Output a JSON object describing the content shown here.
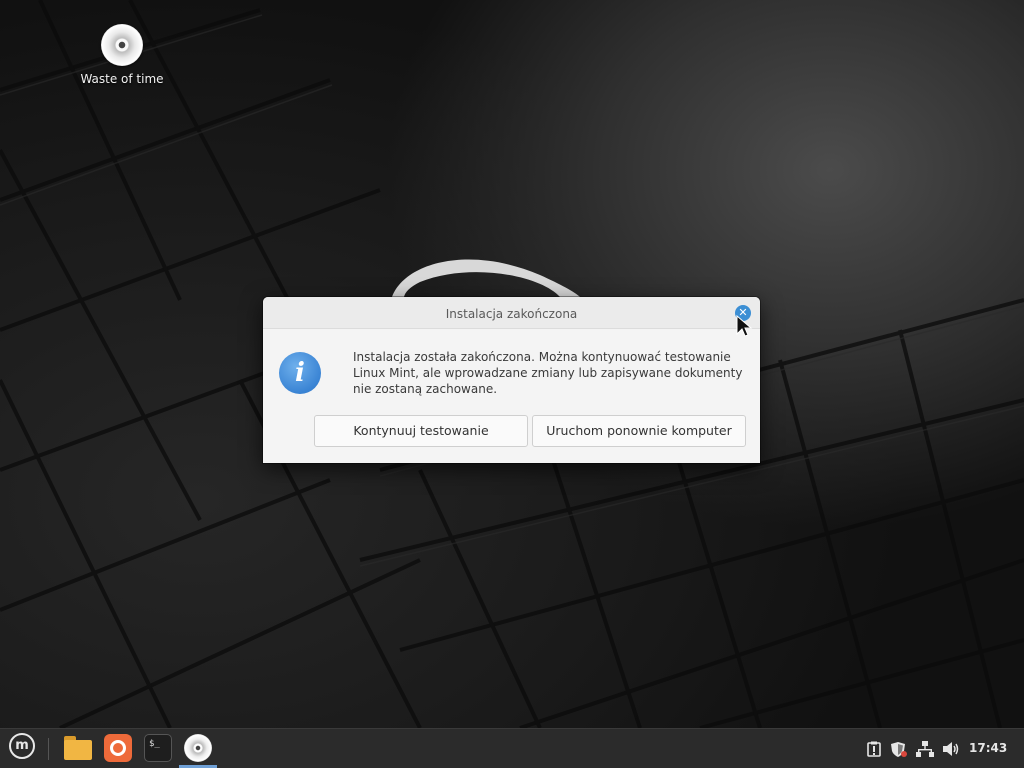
{
  "desktop": {
    "icons": [
      {
        "label": "Waste of time",
        "icon": "disc-icon"
      }
    ]
  },
  "dialog": {
    "title": "Instalacja zakończona",
    "close_glyph": "✕",
    "message": "Instalacja została zakończona. Można kontynuować testowanie Linux Mint, ale wprowadzane zmiany lub zapisywane dokumenty nie zostaną zachowane.",
    "info_glyph": "i",
    "buttons": {
      "continue": "Kontynuuj testowanie",
      "restart": "Uruchom ponownie komputer"
    }
  },
  "taskbar": {
    "menu_glyph": "m",
    "terminal_glyph": "$_",
    "apps": [
      "mint-menu-icon",
      "folder-icon",
      "firefox-icon",
      "terminal-icon",
      "installer-disc-icon"
    ],
    "tray_icons": [
      "clipboard-icon",
      "shield-icon",
      "network-icon",
      "volume-icon"
    ],
    "clock": "17:43"
  },
  "colors": {
    "accent": "#3c8fd4",
    "dialog_bg": "#f4f4f4",
    "taskbar_bg": "#2b2b2b",
    "folder": "#f1b643",
    "firefox": "#ee6a3a"
  }
}
